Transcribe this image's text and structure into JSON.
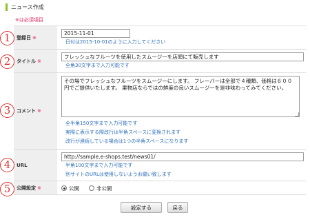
{
  "header": {
    "title": "ニュース作成"
  },
  "required_note": "※は必須項目",
  "badges": [
    "1",
    "2",
    "3",
    "4",
    "5"
  ],
  "fields": {
    "date": {
      "label": "登録日",
      "required_mark": "※",
      "value": "2015-11-01",
      "hint": "日付は2015-10-01のように入力してください"
    },
    "title": {
      "label": "タイトル",
      "required_mark": "※",
      "value": "フレッシュなフルーツを使用したスムージーを店頭にて販売します",
      "hint": "全角30文字まで入力可能です"
    },
    "comment": {
      "label": "コメント",
      "required_mark": "※",
      "value": "その場でフレッシュなフルーツをスムージーにします。 フレーバーは全部で４種類、価格は６００円でご提供いたします。 果物店ならではの鮮度の良いスムージーを是非味わってみてください。",
      "hints": [
        "全半角150文字まで入力可能です",
        "実際に表示する際改行は半角スペースに変換されます",
        "改行が連続している場合は1つの半角スペースになります"
      ]
    },
    "url": {
      "label": "URL",
      "value": "http://sample.e-shops.test/news01/",
      "hints": [
        "半角100文字まで入力可能です",
        "別サイトのURLは使用しないようお願い致します"
      ]
    },
    "publish": {
      "label": "公開設定",
      "required_mark": "※",
      "options": [
        "公開",
        "非公開"
      ],
      "selected": "公開"
    }
  },
  "buttons": {
    "submit": "設定する",
    "back": "戻る"
  },
  "colors": {
    "accent_bar": "#8dc21f",
    "required": "#e0245e",
    "hint": "#2f6fb7",
    "badge": "#e03030"
  }
}
